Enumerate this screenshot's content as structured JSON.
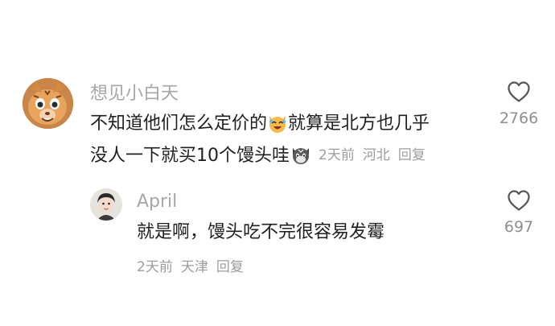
{
  "main_comment": {
    "username": "想见小白天",
    "text_line1": "不知道他们怎么定价的",
    "text_line1_after_emoji": "就算是北方也几乎",
    "text_line2": "没人一下就买10个馒头哇",
    "emoji1": "laughing-cat-emoji",
    "emoji2": "cat-face-emoji",
    "time": "2天前",
    "location": "河北",
    "reply_label": "回复",
    "likes": "2766"
  },
  "reply_comment": {
    "username": "April",
    "text": "就是啊，馒头吃不完很容易发霉",
    "time": "2天前",
    "location": "天津",
    "reply_label": "回复",
    "likes": "697"
  },
  "colors": {
    "text": "#1f1f1f",
    "meta": "#9c9ca1",
    "username": "#a6a6ab",
    "icon": "#555555"
  }
}
